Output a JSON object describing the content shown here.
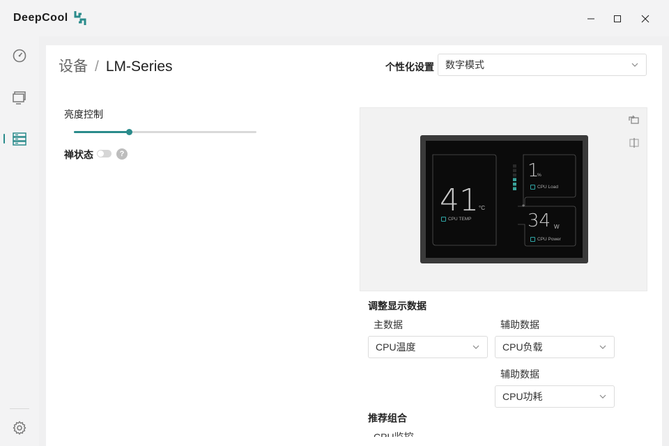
{
  "app": {
    "logo_text": "DeepCool"
  },
  "window_controls": {
    "minimize_icon": "minimize-icon",
    "maximize_icon": "maximize-icon",
    "close_icon": "close-icon"
  },
  "sidebar": {
    "items": [
      {
        "name": "dashboard",
        "icon": "gauge-icon",
        "active": false
      },
      {
        "name": "monitor",
        "icon": "monitor-icon",
        "active": false
      },
      {
        "name": "devices",
        "icon": "server-icon",
        "active": true
      }
    ],
    "settings_icon": "gear-icon"
  },
  "breadcrumb": {
    "root": "设备",
    "separator": "/",
    "current": "LM-Series"
  },
  "personalization": {
    "label": "个性化设置",
    "value": "数字模式"
  },
  "brightness": {
    "label": "亮度控制",
    "value_fraction": 0.3
  },
  "zen_mode": {
    "label": "禅状态",
    "enabled": false,
    "help_text": "?"
  },
  "preview": {
    "rotate_icon": "rotate-icon",
    "mirror_icon": "mirror-icon",
    "screen": {
      "main": {
        "value": "41",
        "unit": "°C",
        "label": "CPU TEMP"
      },
      "aux1": {
        "value": "1",
        "unit": "%",
        "label": "CPU Load"
      },
      "aux2": {
        "value": "34",
        "unit": "W",
        "label": "CPU Power"
      },
      "load_bars": [
        false,
        false,
        false,
        true,
        true,
        true
      ]
    }
  },
  "display_data": {
    "title": "调整显示数据",
    "main_label": "主数据",
    "main_value": "CPU温度",
    "aux1_label": "辅助数据",
    "aux1_value": "CPU负载",
    "aux2_label": "辅助数据",
    "aux2_value": "CPU功耗"
  },
  "recommended": {
    "title": "推荐组合",
    "item": "CPU监控"
  },
  "colors": {
    "accent": "#2a8b8b",
    "screen_frame": "#3a3a3a",
    "screen_bg": "#0b0b0b"
  }
}
